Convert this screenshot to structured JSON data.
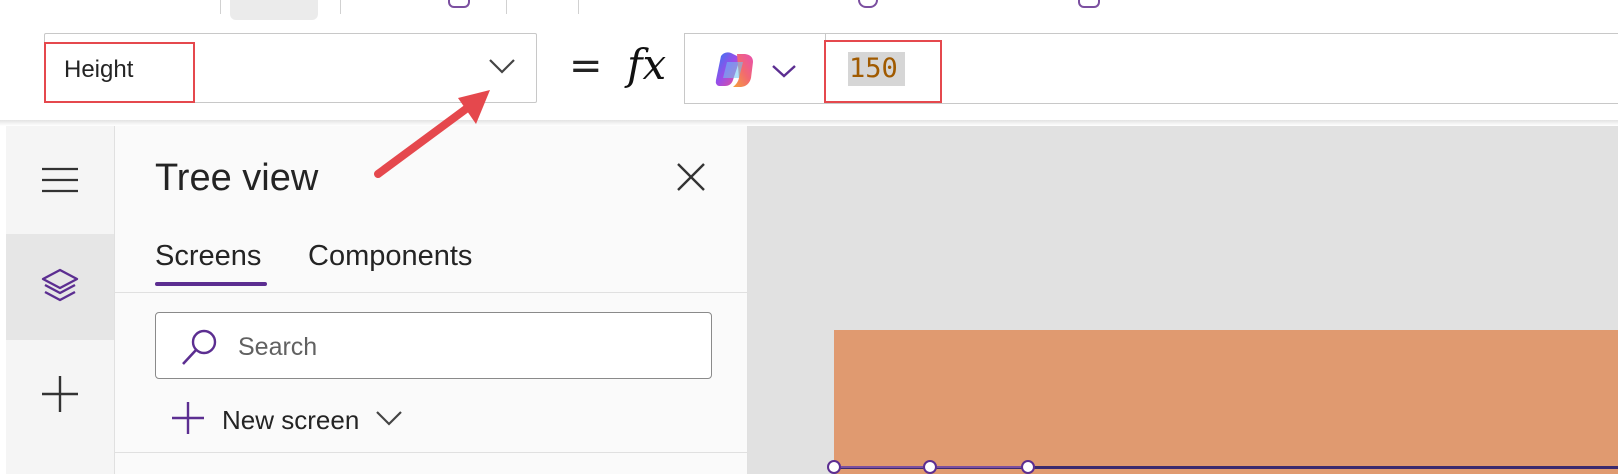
{
  "formula_bar": {
    "property": "Height",
    "equals": "=",
    "fx": "fx",
    "value": "150"
  },
  "tree_view": {
    "title": "Tree view",
    "tabs": [
      {
        "label": "Screens",
        "active": true
      },
      {
        "label": "Components",
        "active": false
      }
    ],
    "search_placeholder": "Search",
    "new_screen_label": "New screen"
  },
  "left_rail": {
    "items": [
      {
        "icon": "hamburger-menu-icon",
        "active": false
      },
      {
        "icon": "layers-icon",
        "active": true
      },
      {
        "icon": "plus-icon",
        "active": false
      }
    ]
  },
  "colors": {
    "accent": "#5c2e91",
    "highlight_box": "#e5484d",
    "annotation_arrow": "#e5484d",
    "screen_fill": "#e09a70",
    "formula_value_text": "#a05a00"
  }
}
